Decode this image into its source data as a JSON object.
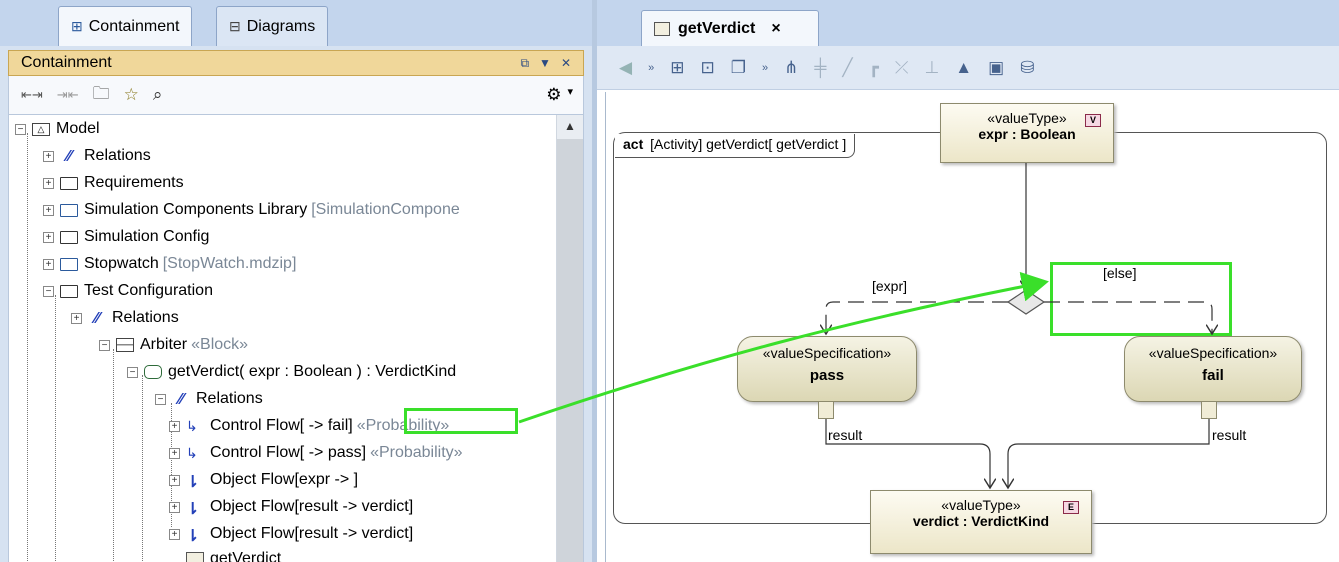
{
  "left_tabs": [
    {
      "label": "Containment",
      "icon": "containment-tree-icon",
      "active": true
    },
    {
      "label": "Diagrams",
      "icon": "diagrams-tree-icon",
      "active": false
    }
  ],
  "panel": {
    "title": "Containment",
    "controls": [
      "float-icon",
      "pin-icon",
      "close-icon"
    ]
  },
  "toolbar_icons": [
    "collapse-all-icon",
    "expand-all-icon",
    "open-folder-icon",
    "favorite-star-icon",
    "search-icon",
    "settings-gear-icon"
  ],
  "tree": [
    {
      "label": "Model",
      "suffix": "",
      "icon": "model-icon",
      "level": 0
    },
    {
      "label": "Relations",
      "suffix": "",
      "icon": "relations-icon",
      "level": 1
    },
    {
      "label": "Requirements",
      "suffix": "",
      "icon": "package-icon",
      "level": 1
    },
    {
      "label": "Simulation Components Library",
      "suffix": "[SimulationCompone",
      "icon": "shared-package-icon",
      "level": 1
    },
    {
      "label": "Simulation Config",
      "suffix": "",
      "icon": "package-icon",
      "level": 1
    },
    {
      "label": "Stopwatch",
      "suffix": "[StopWatch.mdzip]",
      "icon": "shared-package-icon",
      "level": 1
    },
    {
      "label": "Test Configuration",
      "suffix": "",
      "icon": "package-icon",
      "level": 1
    },
    {
      "label": "Relations",
      "suffix": "",
      "icon": "relations-icon",
      "level": 2
    },
    {
      "label": "Arbiter",
      "suffix": "«Block»",
      "icon": "block-icon",
      "level": 2
    },
    {
      "label": "getVerdict( expr : Boolean ) : VerdictKind",
      "suffix": "",
      "icon": "activity-icon",
      "level": 3
    },
    {
      "label": "Relations",
      "suffix": "",
      "icon": "relations-icon",
      "level": 4
    },
    {
      "label": "Control Flow[ -> fail]",
      "suffix": "«Probability»",
      "icon": "control-flow-icon",
      "level": 5
    },
    {
      "label": "Control Flow[ -> pass]",
      "suffix": "«Probability»",
      "icon": "control-flow-icon",
      "level": 5
    },
    {
      "label": "Object Flow[expr -> ]",
      "suffix": "",
      "icon": "object-flow-icon",
      "level": 5
    },
    {
      "label": "Object Flow[result -> verdict]",
      "suffix": "",
      "icon": "object-flow-icon",
      "level": 5
    },
    {
      "label": "Object Flow[result -> verdict]",
      "suffix": "",
      "icon": "object-flow-icon",
      "level": 5
    },
    {
      "label": "getVerdict",
      "suffix": "",
      "icon": "activity-diagram-icon",
      "level": 4
    }
  ],
  "diagram_tab": {
    "label": "getVerdict",
    "close": "×"
  },
  "diagram_toolbar_icons": [
    "back-icon",
    "more-icon",
    "containment-icon",
    "properties-icon",
    "copy-icon",
    "more-icon",
    "layout-icon",
    "align-icon",
    "line-icon",
    "path-icon",
    "split-icon",
    "route-icon",
    "fill-icon",
    "insert-icon",
    "db-icon"
  ],
  "frame": {
    "keyword": "act",
    "kind": "[Activity]",
    "name": "getVerdict[ getVerdict ]"
  },
  "nodes": {
    "expr": {
      "stereotype": "«valueType»",
      "name": "expr : Boolean",
      "badge": "V"
    },
    "pass": {
      "stereotype": "«valueSpecification»",
      "name": "pass"
    },
    "fail": {
      "stereotype": "«valueSpecification»",
      "name": "fail"
    },
    "verdict": {
      "stereotype": "«valueType»",
      "name": "verdict : VerdictKind",
      "badge": "E"
    }
  },
  "guards": {
    "left": "[expr]",
    "right": "[else]"
  },
  "pins": {
    "pass_result": "result",
    "fail_result": "result"
  },
  "colors": {
    "highlight": "#3adf2a",
    "panel_header": "#f0d79a",
    "node_fill": "#ece6c8"
  }
}
